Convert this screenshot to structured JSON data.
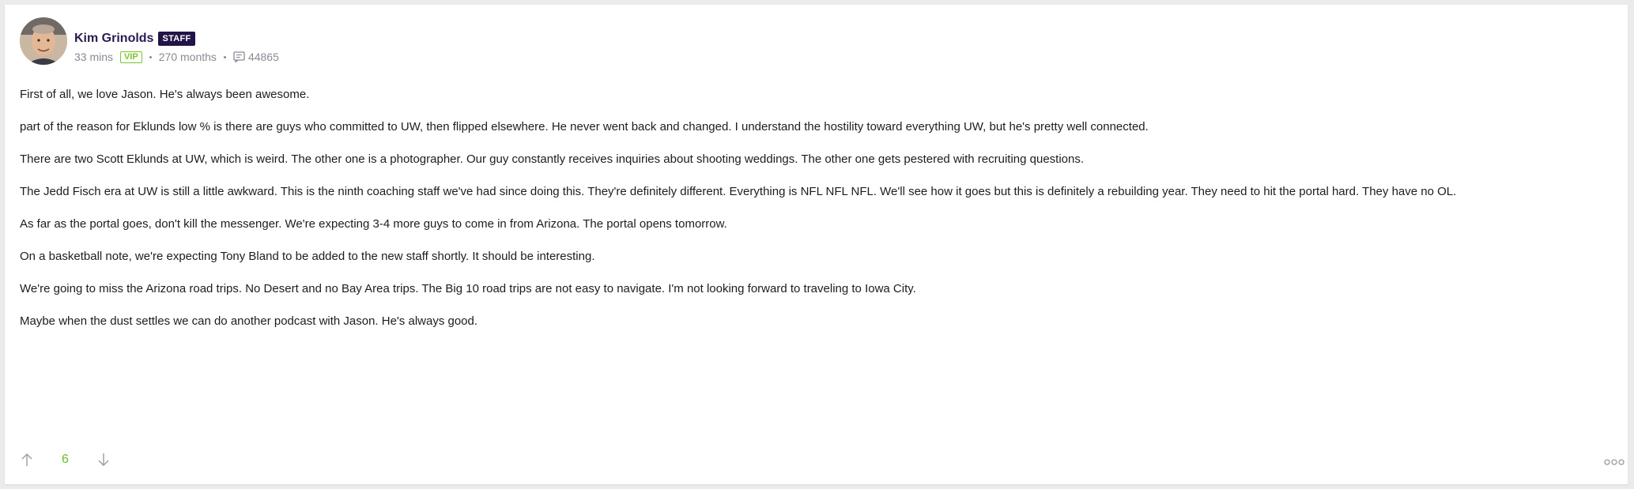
{
  "post": {
    "author": {
      "name": "Kim Grinolds",
      "badge": "STAFF",
      "avatar_icon": "user-avatar"
    },
    "meta": {
      "time": "33 mins",
      "status_badge": "VIP",
      "tenure": "270 months",
      "post_count": "44865",
      "post_count_icon": "message-icon"
    },
    "paragraphs": [
      "First of all, we love Jason. He's always been awesome.",
      "part of the reason for Eklunds low % is there are guys who committed to UW, then flipped elsewhere. He never went back and changed. I understand the hostility toward everything UW, but he's pretty well connected.",
      "There are two Scott Eklunds at UW, which is weird. The other one is a photographer. Our guy constantly receives inquiries about shooting weddings. The other one gets pestered with recruiting questions.",
      "The Jedd Fisch era at UW is still a little awkward. This is the ninth coaching staff we've had since doing this. They're definitely different. Everything is NFL NFL NFL. We'll see how it goes but this is definitely a rebuilding year. They need to hit the portal hard. They have no OL.",
      "As far as the portal goes, don't kill the messenger. We're expecting 3-4 more guys to come in from Arizona. The portal opens tomorrow.",
      "On a basketball note, we're expecting Tony Bland to be added to the new staff shortly. It should be interesting.",
      "We're going to miss the Arizona road trips. No Desert and no Bay Area trips. The Big 10 road trips are not easy to navigate. I'm not looking forward to traveling to Iowa City.",
      "Maybe when the dust settles we can do another podcast with Jason. He's always good."
    ],
    "footer": {
      "vote_count": "6",
      "upvote_icon": "arrow-up-icon",
      "downvote_icon": "arrow-down-icon",
      "more_icon": "more-options-icon"
    }
  },
  "colors": {
    "staff_badge_bg": "#231448",
    "author_name": "#2b1a52",
    "vip": "#7bc62d",
    "vote_count": "#6abf22",
    "meta_text": "#8a8a96"
  }
}
